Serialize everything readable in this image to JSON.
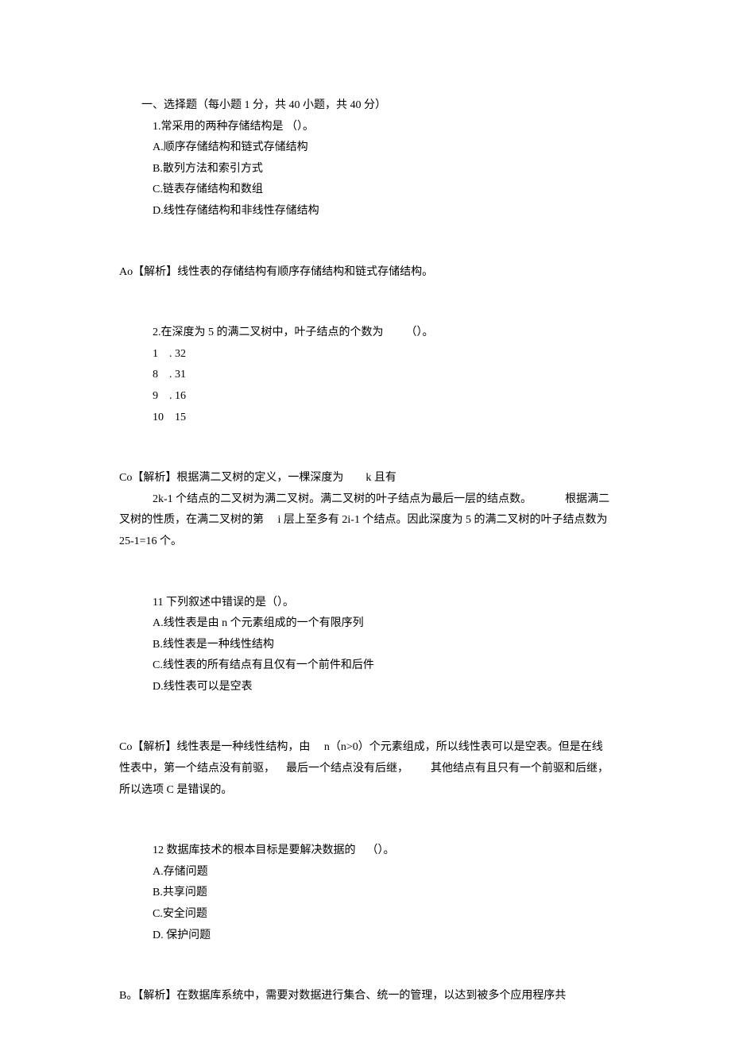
{
  "section": {
    "title": "一、选择题（每小题 1 分，共 40 小题，共 40 分）"
  },
  "q1": {
    "stem": "1.常采用的两种存储结构是 （）。",
    "A": "A.顺序存储结构和链式存储结构",
    "B": "B.散列方法和索引方式",
    "C": "C.链表存储结构和数组",
    "D": "D.线性存储结构和非线性存储结构",
    "ans": "Ao【解析】线性表的存储结构有顺序存储结构和链式存储结构。"
  },
  "q2": {
    "stem": "2.在深度为 5 的满二叉树中，叶子结点的个数为  （）。",
    "A": "1 . 32",
    "B": "8 . 31",
    "C": "9 . 16",
    "D": "10 15",
    "ans1": "Co【解析】根据满二叉树的定义，一棵深度为  k 且有",
    "ans2": "2k-1 个结点的二叉树为满二叉树。满二叉树的叶子结点为最后一层的结点数。   根据满二叉树的性质，在满二叉树的第  i 层上至多有 2i-1 个结点。因此深度为 5 的满二叉树的叶子结点数为 25-1=16 个。"
  },
  "q3": {
    "stem": "11 下列叙述中错误的是（）。",
    "A": "A.线性表是由 n 个元素组成的一个有限序列",
    "B": "B.线性表是一种线性结构",
    "C": "C.线性表的所有结点有且仅有一个前件和后件",
    "D": "D.线性表可以是空表",
    "ans": "Co【解析】线性表是一种线性结构，由  n（n>0）个元素组成，所以线性表可以是空表。但是在线性表中，第一个结点没有前驱， 最后一个结点没有后继，  其他结点有且只有一个前驱和后继，所以选项 C 是错误的。"
  },
  "q4": {
    "stem": "12 数据库技术的根本目标是要解决数据的 （）。",
    "A": "A.存储问题",
    "B": "B.共享问题",
    "C": "C.安全问题",
    "D": "D. 保护问题",
    "ans": "B。【解析】在数据库系统中，需要对数据进行集合、统一的管理，以达到被多个应用程序共"
  }
}
